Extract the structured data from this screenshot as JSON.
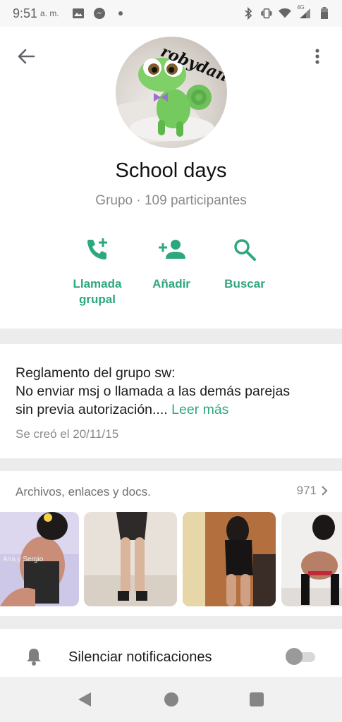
{
  "status_bar": {
    "time": "9:51",
    "ampm": "a. m.",
    "network_label": "4G"
  },
  "header": {
    "avatar_text": "robydan",
    "title": "School days",
    "subtitle": "Grupo · 109 participantes"
  },
  "actions": {
    "call_line1": "Llamada",
    "call_line2": "grupal",
    "add_label": "Añadir",
    "search_label": "Buscar"
  },
  "description": {
    "line1": "Reglamento del grupo sw:",
    "line2": "No enviar msj o llamada a las demás parejas",
    "line3": "sin previa autorización....",
    "more": "Leer más",
    "created": "Se creó el 20/11/15"
  },
  "media": {
    "title": "Archivos, enlaces y docs.",
    "count": "971",
    "thumb1_caption": "Ana y Sergio"
  },
  "mute": {
    "label": "Silenciar notificaciones",
    "enabled": false
  },
  "colors": {
    "accent": "#2fa77d",
    "secondary_text": "#8a8a8a"
  }
}
